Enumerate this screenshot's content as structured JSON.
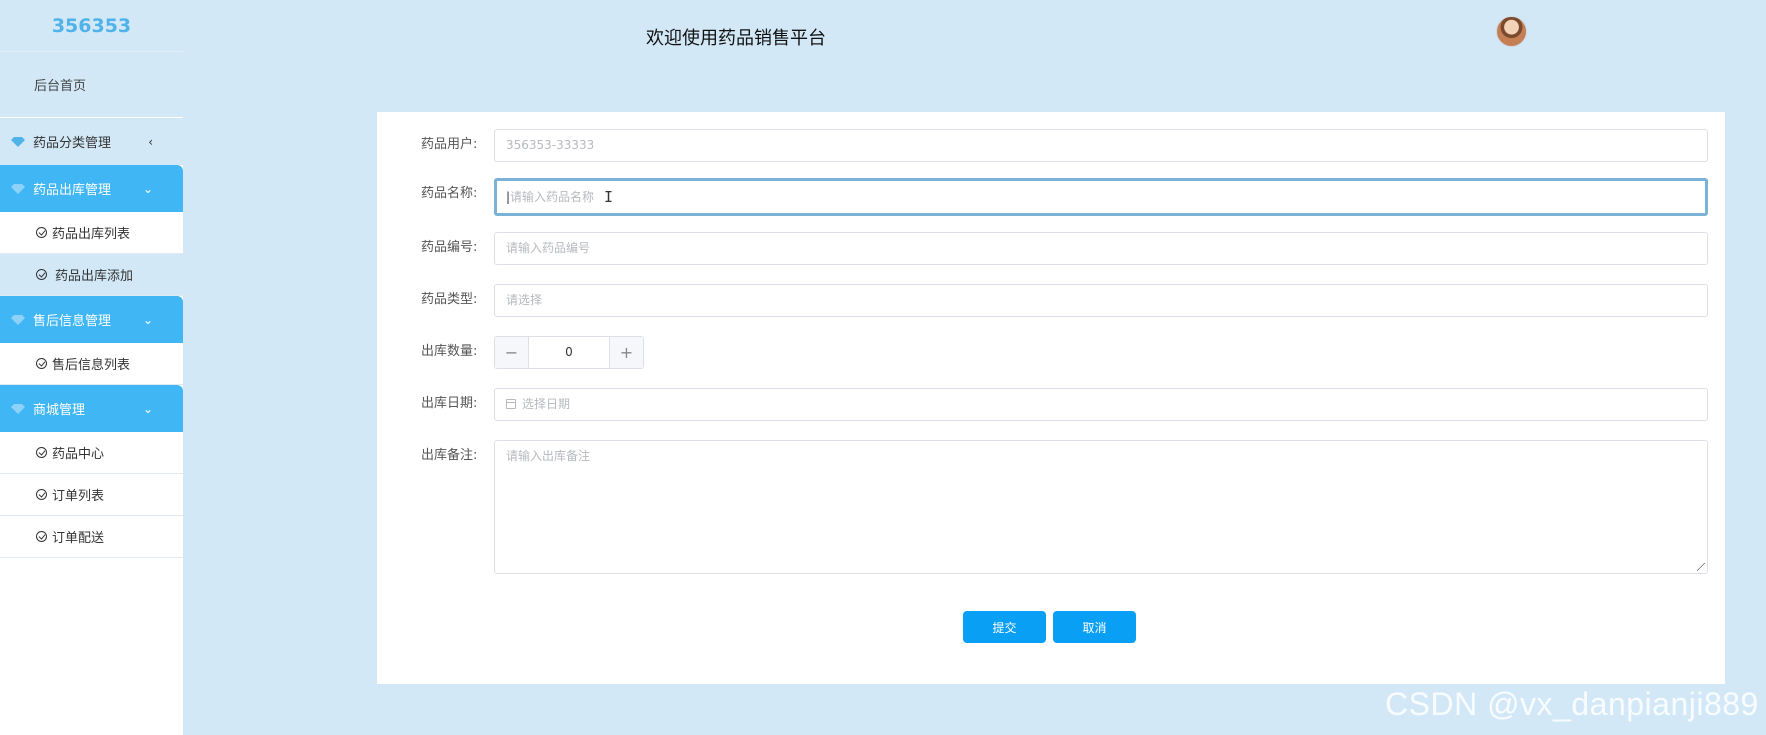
{
  "sidebar": {
    "logo": "356353",
    "home": "后台首页",
    "groups": [
      {
        "label": "药品分类管理",
        "state": "collapsed",
        "arrow": "‹"
      },
      {
        "label": "药品出库管理",
        "state": "open",
        "arrow": "⌄",
        "items": [
          {
            "label": "药品出库列表",
            "active": false
          },
          {
            "label": "药品出库添加",
            "active": true
          }
        ]
      },
      {
        "label": "售后信息管理",
        "state": "open",
        "arrow": "⌄",
        "items": [
          {
            "label": "售后信息列表",
            "active": false
          }
        ]
      },
      {
        "label": "商城管理",
        "state": "open",
        "arrow": "⌄",
        "items": [
          {
            "label": "药品中心",
            "active": false
          },
          {
            "label": "订单列表",
            "active": false
          },
          {
            "label": "订单配送",
            "active": false
          }
        ]
      }
    ]
  },
  "header": {
    "title": "欢迎使用药品销售平台",
    "avatar_icon": "user-avatar"
  },
  "form": {
    "user": {
      "label": "药品用户:",
      "value": "356353-33333"
    },
    "name": {
      "label": "药品名称:",
      "placeholder": "请输入药品名称"
    },
    "code": {
      "label": "药品编号:",
      "placeholder": "请输入药品编号"
    },
    "type": {
      "label": "药品类型:",
      "placeholder": "请选择"
    },
    "quantity": {
      "label": "出库数量:",
      "value": "0",
      "minus": "−",
      "plus": "+"
    },
    "date": {
      "label": "出库日期:",
      "placeholder": "选择日期"
    },
    "remark": {
      "label": "出库备注:",
      "placeholder": "请输入出库备注"
    },
    "submit": "提交",
    "cancel": "取消"
  },
  "watermark": "CSDN @vx_danpianji889",
  "colors": {
    "accent": "#40b7f4",
    "background": "#d2e8f7",
    "button": "#089ff4"
  }
}
